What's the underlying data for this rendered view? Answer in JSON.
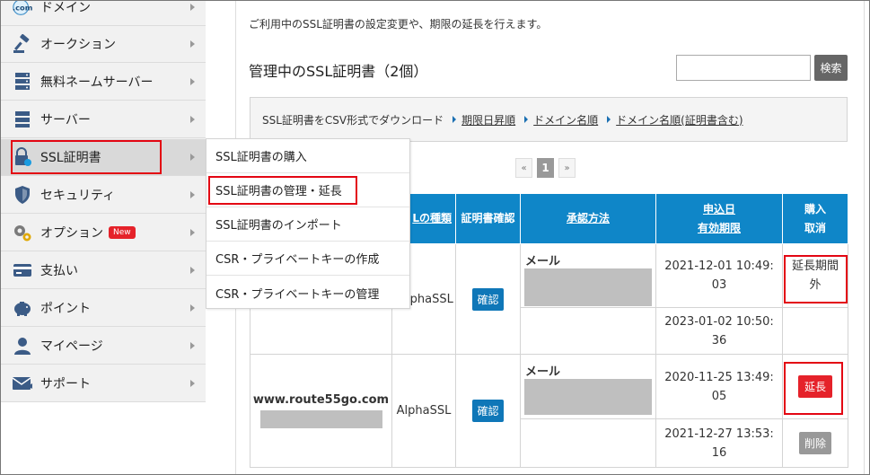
{
  "sidebar": {
    "items": [
      {
        "label": "ドメイン",
        "icon": "com-icon"
      },
      {
        "label": "オークション",
        "icon": "gavel-icon"
      },
      {
        "label": "無料ネームサーバー",
        "icon": "server-stack-icon"
      },
      {
        "label": "サーバー",
        "icon": "server-icon"
      },
      {
        "label": "SSL証明書",
        "icon": "ssl-lock-icon"
      },
      {
        "label": "セキュリティ",
        "icon": "shield-icon"
      },
      {
        "label": "オプション",
        "icon": "gears-icon",
        "badge": "New"
      },
      {
        "label": "支払い",
        "icon": "card-icon"
      },
      {
        "label": "ポイント",
        "icon": "piggy-bank-icon"
      },
      {
        "label": "マイページ",
        "icon": "person-icon"
      },
      {
        "label": "サポート",
        "icon": "mail-icon"
      }
    ]
  },
  "flyout": {
    "items": [
      "SSL証明書の購入",
      "SSL証明書の管理・延長",
      "SSL証明書のインポート",
      "CSR・プライベートキーの作成",
      "CSR・プライベートキーの管理"
    ]
  },
  "main": {
    "intro": "ご利用中のSSL証明書の設定変更や、期限の延長を行えます。",
    "heading": "管理中のSSL証明書（2個）",
    "search_button": "検索",
    "csv_label": "SSL証明書をCSV形式でダウンロード",
    "csv_links": [
      "期限日昇順",
      "ドメイン名順",
      "ドメイン名順(証明書含む)"
    ],
    "pager": {
      "prev": "«",
      "current": "1",
      "next": "»"
    }
  },
  "table": {
    "headers": {
      "type": "Lの種類",
      "confirm": "証明書確認",
      "method": "承認方法",
      "dates1": "申込日",
      "dates2": "有効期限",
      "action1": "購入",
      "action2": "取消"
    },
    "rows": [
      {
        "domain": "",
        "type": "lphaSSL",
        "confirm": "確認",
        "method": "メール",
        "apply_date_1": "2021-12-01 10:49:",
        "apply_date_2": "03",
        "expire_date_1": "2023-01-02 10:50:",
        "expire_date_2": "36",
        "status_1": "延長期間",
        "status_2": "外"
      },
      {
        "domain": "www.route55go.com",
        "type": "AlphaSSL",
        "confirm": "確認",
        "method": "メール",
        "apply_date_1": "2020-11-25 13:49:",
        "apply_date_2": "05",
        "expire_date_1": "2021-12-27 13:53:",
        "expire_date_2": "16",
        "extend": "延長",
        "delete": "削除"
      }
    ]
  }
}
